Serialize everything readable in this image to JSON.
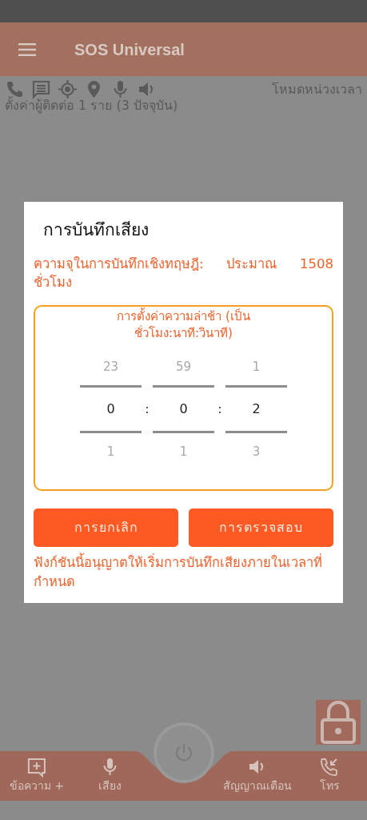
{
  "app_bar": {
    "title": "SOS Universal"
  },
  "status": {
    "mode": "โหมดหน่วงเวลา",
    "contacts": "ตั้งค่าผู้ติดต่อ 1 ราย (3 ปัจจุบัน)"
  },
  "dialog": {
    "title": "การบันทึกเสียง",
    "capacity_note": "ความจุในการบันทึกเชิงทฤษฎี: ประมาณ 1508 ชั่วโมง",
    "delay": {
      "label": "การตั้งค่าความล่าช้า (เป็น ชั่วโมง:นาที:วินาที)",
      "separators": [
        ":",
        ":"
      ],
      "columns": [
        {
          "previous": "23",
          "value": "0",
          "next": "1"
        },
        {
          "previous": "59",
          "value": "0",
          "next": "1"
        },
        {
          "previous": "1",
          "value": "2",
          "next": "3"
        }
      ]
    },
    "buttons": [
      {
        "label": "การยกเลิก"
      },
      {
        "label": "การตรวจสอบ"
      }
    ],
    "footnote": "ฟังก์ชันนี้อนุญาตให้เริ่มการบันทึกเสียงภายในเวลาที่กำหนด"
  },
  "bottom_nav": [
    {
      "label": "ข้อความ +"
    },
    {
      "label": "เสียง"
    },
    {
      "label": "สัญญาณเตือน"
    },
    {
      "label": "โทร"
    }
  ]
}
